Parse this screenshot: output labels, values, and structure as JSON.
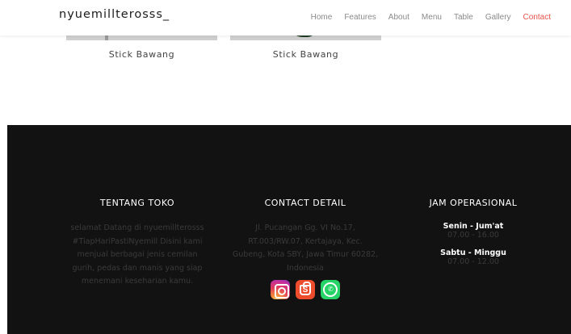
{
  "brand": "nyuemillterosss_",
  "nav": {
    "items": [
      "Home",
      "Features",
      "About",
      "Menu",
      "Table",
      "Gallery",
      "Contact"
    ],
    "active": "Contact"
  },
  "products": [
    {
      "label": "Stick Bawang"
    },
    {
      "label": "Stick Bawang"
    }
  ],
  "footer": {
    "about": {
      "title": "TENTANG TOKO",
      "lines": [
        "selamat Datang di nyuemillterosss",
        "#TiapHariPastiNyemill Disini kami",
        "menjual berbagai jenis cemilan",
        "gurih, pedas dan manis yang siap",
        "menemani keseharian kamu."
      ]
    },
    "contact": {
      "title": "CONTACT DETAIL",
      "lines": [
        "Jl. Pucangan Gg. VI No.17,",
        "RT.003/RW.07, Kertajaya, Kec.",
        "Gubeng, Kota SBY, Jawa Timur 60282,",
        "Indonesia"
      ],
      "social": [
        {
          "icon": "instagram-icon"
        },
        {
          "icon": "shopee-icon"
        },
        {
          "icon": "whatsapp-icon"
        }
      ]
    },
    "hours": {
      "title": "JAM OPERASIONAL",
      "rows": [
        {
          "day": "Senin - Jum'at",
          "time": "07.00 - 16.00"
        },
        {
          "day": "Sabtu - Minggu",
          "time": "07.00 - 12.00"
        }
      ]
    }
  },
  "colors": {
    "accent": "#e8524a",
    "footer_bg": "#121212",
    "muted_text": "#3a3a3a"
  }
}
